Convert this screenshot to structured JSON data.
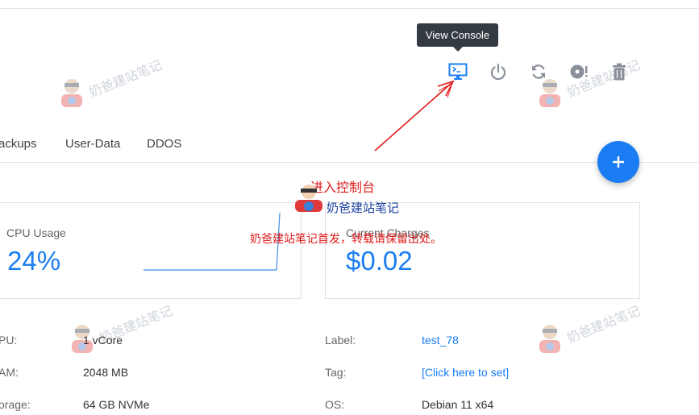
{
  "tooltip": {
    "text": "View Console"
  },
  "actions": [
    {
      "name": "console",
      "icon": "monitor-icon"
    },
    {
      "name": "power",
      "icon": "power-icon"
    },
    {
      "name": "reinstall",
      "icon": "refresh-icon"
    },
    {
      "name": "iso",
      "icon": "disc-icon"
    },
    {
      "name": "delete",
      "icon": "trash-icon"
    }
  ],
  "tabs": [
    {
      "label": "ackups"
    },
    {
      "label": "User-Data"
    },
    {
      "label": "DDOS"
    }
  ],
  "fab": {
    "icon": "plus-icon"
  },
  "cards": {
    "cpu": {
      "label": "CPU Usage",
      "value": "24%"
    },
    "charges": {
      "label": "Current Charges",
      "value": "$0.02"
    }
  },
  "details_left": [
    {
      "label": "PU:",
      "value": "1 vCore"
    },
    {
      "label": "AM:",
      "value": "2048 MB"
    },
    {
      "label": "orage:",
      "value": "64 GB NVMe"
    }
  ],
  "details_right": [
    {
      "label": "Label:",
      "value": "test_78"
    },
    {
      "label": "Tag:",
      "value": "[Click here to set]"
    },
    {
      "label": "OS:",
      "value": "Debian 11 x64"
    }
  ],
  "overlay": {
    "title": "进入控制台",
    "brand": "奶爸建站笔记",
    "notice": "奶爸建站笔记首发，转载请保留出处。"
  },
  "watermark": {
    "text": "奶爸建站笔记"
  },
  "colors": {
    "accent": "#1b7df3",
    "annotation": "#e01a1a",
    "tooltip_bg": "#333a41",
    "icon": "#8a9099"
  }
}
